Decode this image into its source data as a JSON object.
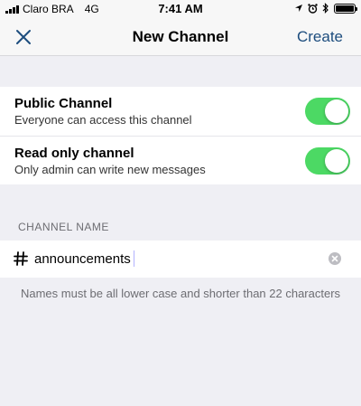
{
  "status_bar": {
    "carrier": "Claro BRA",
    "network": "4G",
    "time": "7:41 AM",
    "icons": [
      "location-arrow-icon",
      "alarm-icon",
      "bluetooth-icon",
      "battery-icon"
    ],
    "battery_level": 1.0
  },
  "nav": {
    "close_icon": "close-icon",
    "title": "New Channel",
    "action_label": "Create"
  },
  "toggles": [
    {
      "title": "Public Channel",
      "subtitle": "Everyone can access this channel",
      "on": true
    },
    {
      "title": "Read only channel",
      "subtitle": "Only admin can write new messages",
      "on": true
    }
  ],
  "channel": {
    "section_header": "CHANNEL NAME",
    "prefix_icon": "hash-icon",
    "value": "announcements",
    "clear_icon": "clear-icon",
    "helper_text": "Names must be all lower case and shorter than 22 characters"
  },
  "colors": {
    "accent": "#1d4d7e",
    "switch_on": "#4cd964",
    "background": "#efeff4"
  }
}
